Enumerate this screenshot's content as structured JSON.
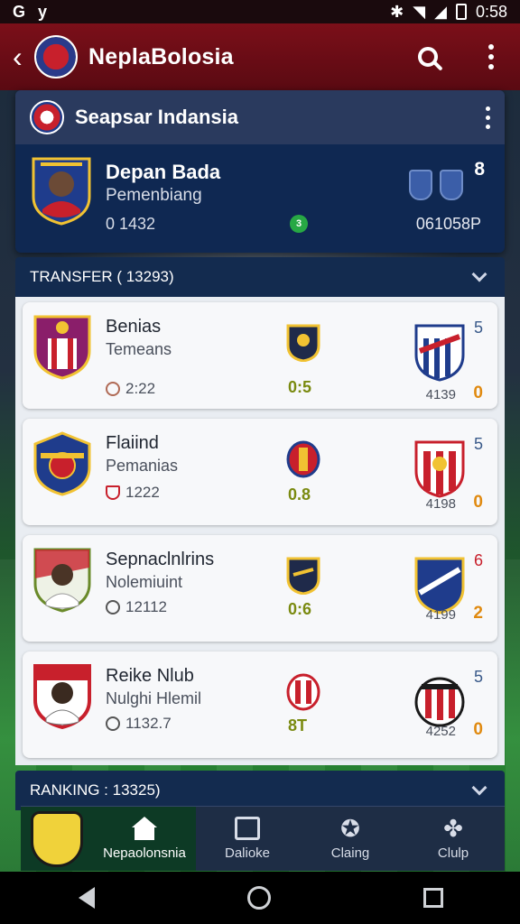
{
  "status_bar": {
    "time": "0:58",
    "left_icons": [
      "G",
      "y"
    ]
  },
  "app_bar": {
    "title": "NeplaBolosia"
  },
  "club_card": {
    "title": "Seapsar Indansia",
    "player": {
      "name": "Depan Bada",
      "role": "Pemenbiang",
      "value": "0 1432",
      "right_value": "061058P",
      "rank": "8",
      "indicator": "3"
    }
  },
  "transfer_section": {
    "label": "TRANSFER ( 13293)",
    "items": [
      {
        "name": "Benias",
        "sub": "Temeans",
        "meta": "2:22",
        "score": "0:5",
        "rank": "5",
        "pts": "4139",
        "small": "0",
        "rank_color": "blue"
      },
      {
        "name": "Flaiind",
        "sub": "Pemanias",
        "meta": "1222",
        "score": "0.8",
        "rank": "5",
        "pts": "4198",
        "small": "0",
        "rank_color": "blue"
      },
      {
        "name": "Sepnaclnlrins",
        "sub": "Nolemiuint",
        "meta": "12112",
        "score": "0:6",
        "rank": "6",
        "pts": "4199",
        "small": "2",
        "rank_color": "red"
      },
      {
        "name": "Reike Nlub",
        "sub": "Nulghi Hlemil",
        "meta": "1132.7",
        "score": "8T",
        "rank": "5",
        "pts": "4252",
        "small": "0",
        "rank_color": "blue"
      }
    ]
  },
  "ranking_section": {
    "label": "RANKING : 13325)"
  },
  "bottom_nav": {
    "items": [
      {
        "label": "Nepaolonsnia",
        "icon": "home-icon",
        "active": true
      },
      {
        "label": "Dalioke",
        "icon": "layers-icon",
        "active": false
      },
      {
        "label": "Claing",
        "icon": "star-badge-icon",
        "active": false
      },
      {
        "label": "Clulp",
        "icon": "club-icon",
        "active": false
      }
    ]
  },
  "colors": {
    "app_bar": "#7b0f19",
    "card_dark": "#0f2852",
    "accent_green": "#27a844",
    "score": "#7a8a10",
    "orange": "#e08a10"
  }
}
